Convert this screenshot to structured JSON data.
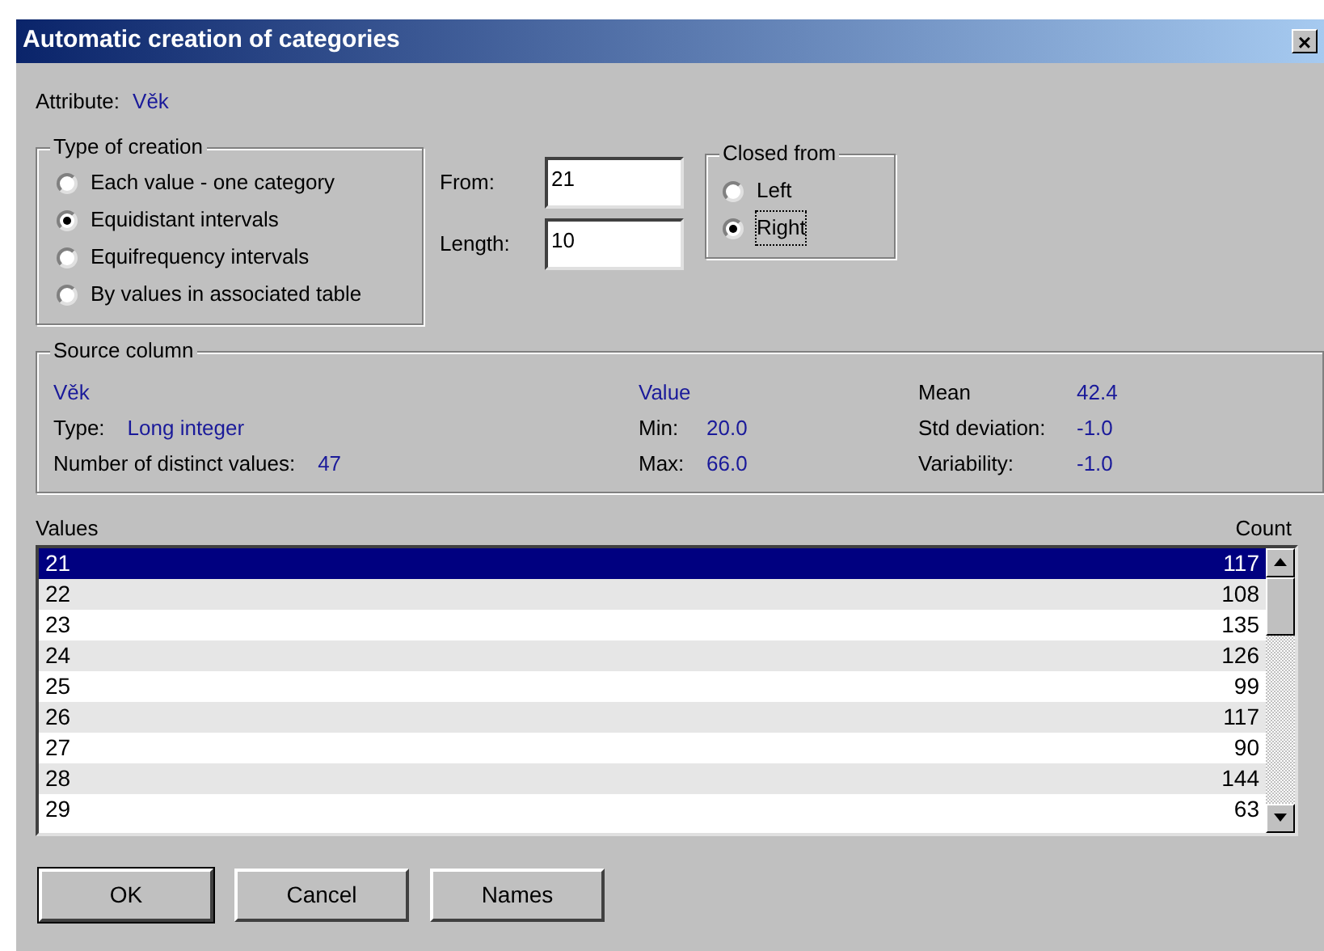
{
  "window": {
    "title": "Automatic creation of categories",
    "close": "×"
  },
  "attribute": {
    "label": "Attribute:",
    "value": "Věk"
  },
  "type_of_creation": {
    "title": "Type of creation",
    "options": [
      {
        "label": "Each value - one category",
        "selected": false
      },
      {
        "label": "Equidistant intervals",
        "selected": true
      },
      {
        "label": "Equifrequency intervals",
        "selected": false
      },
      {
        "label": "By values in associated table",
        "selected": false
      }
    ]
  },
  "fields": [
    {
      "label": "From:",
      "value": "21"
    },
    {
      "label": "Length:",
      "value": "10"
    }
  ],
  "closed_from": {
    "title": "Closed from",
    "options": [
      {
        "label": "Left",
        "selected": false,
        "focused": false
      },
      {
        "label": "Right",
        "selected": true,
        "focused": true
      }
    ]
  },
  "source_column": {
    "title": "Source column",
    "name": "Věk",
    "type_label": "Type:",
    "type_value": "Long integer",
    "distinct_label": "Number of distinct values:",
    "distinct_value": "47",
    "value_heading": "Value",
    "min_label": "Min:",
    "min_value": "20.0",
    "max_label": "Max:",
    "max_value": "66.0",
    "stats": [
      {
        "label": "Mean",
        "value": "42.4"
      },
      {
        "label": "Std deviation:",
        "value": "-1.0"
      },
      {
        "label": "Variability:",
        "value": "-1.0"
      }
    ]
  },
  "values_list": {
    "columns": [
      {
        "label": "Values"
      },
      {
        "label": "Count"
      }
    ],
    "rows": [
      {
        "value": "21",
        "count": "117",
        "selected": true
      },
      {
        "value": "22",
        "count": "108",
        "selected": false
      },
      {
        "value": "23",
        "count": "135",
        "selected": false
      },
      {
        "value": "24",
        "count": "126",
        "selected": false
      },
      {
        "value": "25",
        "count": "99",
        "selected": false
      },
      {
        "value": "26",
        "count": "117",
        "selected": false
      },
      {
        "value": "27",
        "count": "90",
        "selected": false
      },
      {
        "value": "28",
        "count": "144",
        "selected": false
      },
      {
        "value": "29",
        "count": "63",
        "selected": false
      }
    ]
  },
  "buttons": [
    {
      "label": "OK",
      "default": true
    },
    {
      "label": "Cancel",
      "default": false
    },
    {
      "label": "Names",
      "default": false
    }
  ]
}
